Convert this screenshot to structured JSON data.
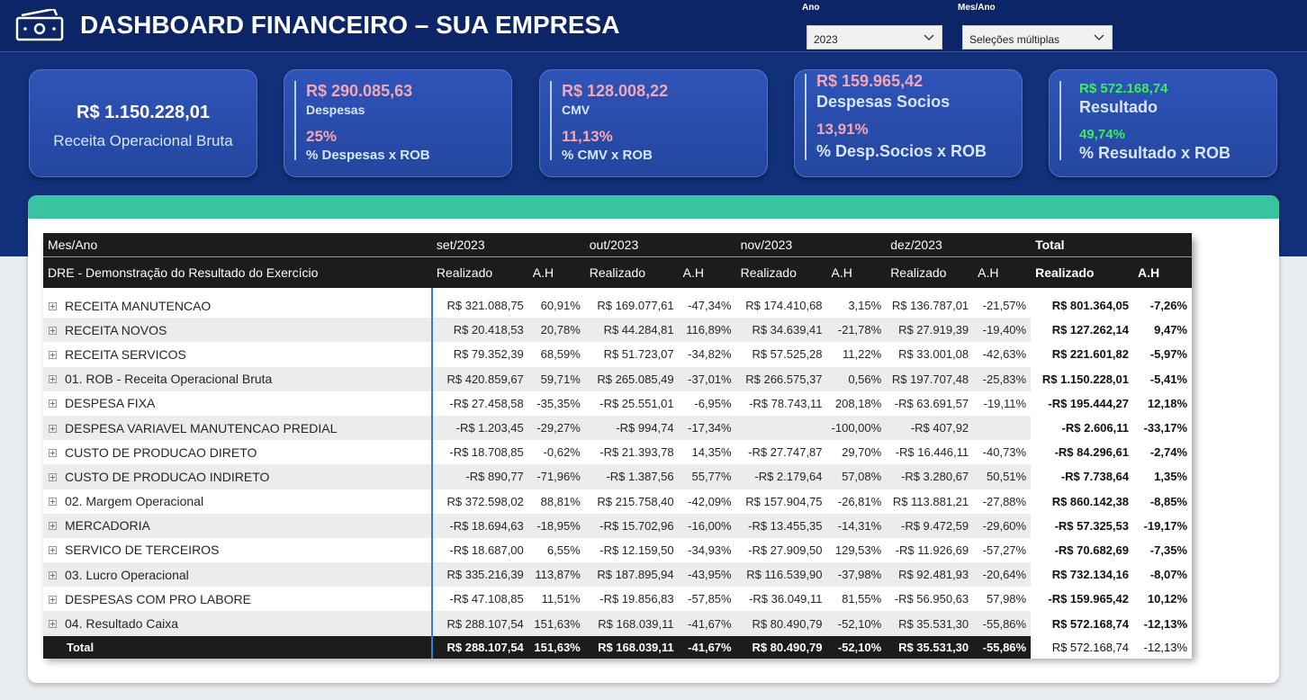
{
  "header": {
    "title": "DASHBOARD FINANCEIRO – SUA EMPRESA",
    "logo_icon": "money-bill-icon",
    "filters": [
      {
        "label": "Ano",
        "value": "2023"
      },
      {
        "label": "Mes/Ano",
        "value": "Seleções múltiplas"
      }
    ]
  },
  "cards": [
    {
      "value": "R$ 1.150.228,01",
      "label": "Receita Operacional Bruta"
    },
    {
      "value": "R$ 290.085,63",
      "label": "Despesas",
      "pct": "25%",
      "pct_label": "% Despesas x ROB"
    },
    {
      "value": "R$ 128.008,22",
      "label": "CMV",
      "pct": "11,13%",
      "pct_label": "% CMV x ROB"
    },
    {
      "value": "R$ 159.965,42",
      "label": "Despesas Socios",
      "pct": "13,91%",
      "pct_label": "% Desp.Socios x ROB"
    },
    {
      "value": "R$ 572.168,74",
      "label": "Resultado",
      "pct": "49,74%",
      "pct_label": "% Resultado x ROB"
    }
  ],
  "colors": {
    "pink": "#f4a6b6",
    "green": "#38ef5a",
    "teal": "#39c3a0",
    "navy": "#12307a"
  },
  "table": {
    "corner_top": "Mes/Ano",
    "corner_bottom": "DRE - Demonstração do Resultado do Exercício",
    "months": [
      "set/2023",
      "out/2023",
      "nov/2023",
      "dez/2023",
      "Total"
    ],
    "sub_realizado": "Realizado",
    "sub_ah": "A.H",
    "rows": [
      {
        "name": "RECEITA MANUTENCAO",
        "c": [
          "R$ 321.088,75",
          "60,91%",
          "R$ 169.077,61",
          "-47,34%",
          "R$ 174.410,68",
          "3,15%",
          "R$ 136.787,01",
          "-21,57%",
          "R$ 801.364,05",
          "-7,26%"
        ]
      },
      {
        "name": "RECEITA NOVOS",
        "c": [
          "R$ 20.418,53",
          "20,78%",
          "R$ 44.284,81",
          "116,89%",
          "R$ 34.639,41",
          "-21,78%",
          "R$ 27.919,39",
          "-19,40%",
          "R$ 127.262,14",
          "9,47%"
        ]
      },
      {
        "name": "RECEITA SERVICOS",
        "c": [
          "R$ 79.352,39",
          "68,59%",
          "R$ 51.723,07",
          "-34,82%",
          "R$ 57.525,28",
          "11,22%",
          "R$ 33.001,08",
          "-42,63%",
          "R$ 221.601,82",
          "-5,97%"
        ]
      },
      {
        "name": "01. ROB - Receita Operacional Bruta",
        "c": [
          "R$ 420.859,67",
          "59,71%",
          "R$ 265.085,49",
          "-37,01%",
          "R$ 266.575,37",
          "0,56%",
          "R$ 197.707,48",
          "-25,83%",
          "R$ 1.150.228,01",
          "-5,41%"
        ]
      },
      {
        "name": "DESPESA FIXA",
        "c": [
          "-R$ 27.458,58",
          "-35,35%",
          "-R$ 25.551,01",
          "-6,95%",
          "-R$ 78.743,11",
          "208,18%",
          "-R$ 63.691,57",
          "-19,11%",
          "-R$ 195.444,27",
          "12,18%"
        ]
      },
      {
        "name": "DESPESA VARIAVEL MANUTENCAO PREDIAL",
        "c": [
          "-R$ 1.203,45",
          "-29,27%",
          "-R$ 994,74",
          "-17,34%",
          "",
          "-100,00%",
          "-R$ 407,92",
          "",
          "-R$ 2.606,11",
          "-33,17%"
        ]
      },
      {
        "name": "CUSTO DE PRODUCAO DIRETO",
        "c": [
          "-R$ 18.708,85",
          "-0,62%",
          "-R$ 21.393,78",
          "14,35%",
          "-R$ 27.747,87",
          "29,70%",
          "-R$ 16.446,11",
          "-40,73%",
          "-R$ 84.296,61",
          "-2,74%"
        ]
      },
      {
        "name": "CUSTO DE PRODUCAO INDIRETO",
        "c": [
          "-R$ 890,77",
          "-71,96%",
          "-R$ 1.387,56",
          "55,77%",
          "-R$ 2.179,64",
          "57,08%",
          "-R$ 3.280,67",
          "50,51%",
          "-R$ 7.738,64",
          "1,35%"
        ]
      },
      {
        "name": "02. Margem Operacional",
        "c": [
          "R$ 372.598,02",
          "88,81%",
          "R$ 215.758,40",
          "-42,09%",
          "R$ 157.904,75",
          "-26,81%",
          "R$ 113.881,21",
          "-27,88%",
          "R$ 860.142,38",
          "-8,85%"
        ]
      },
      {
        "name": "MERCADORIA",
        "c": [
          "-R$ 18.694,63",
          "-18,95%",
          "-R$ 15.702,96",
          "-16,00%",
          "-R$ 13.455,35",
          "-14,31%",
          "-R$ 9.472,59",
          "-29,60%",
          "-R$ 57.325,53",
          "-19,17%"
        ]
      },
      {
        "name": "SERVICO DE TERCEIROS",
        "c": [
          "-R$ 18.687,00",
          "6,55%",
          "-R$ 12.159,50",
          "-34,93%",
          "-R$ 27.909,50",
          "129,53%",
          "-R$ 11.926,69",
          "-57,27%",
          "-R$ 70.682,69",
          "-7,35%"
        ]
      },
      {
        "name": "03. Lucro Operacional",
        "c": [
          "R$ 335.216,39",
          "113,87%",
          "R$ 187.895,94",
          "-43,95%",
          "R$ 116.539,90",
          "-37,98%",
          "R$ 92.481,93",
          "-20,64%",
          "R$ 732.134,16",
          "-8,07%"
        ]
      },
      {
        "name": "DESPESAS COM PRO LABORE",
        "c": [
          "-R$ 47.108,85",
          "11,51%",
          "-R$ 19.856,83",
          "-57,85%",
          "-R$ 36.049,11",
          "81,55%",
          "-R$ 56.950,63",
          "57,98%",
          "-R$ 159.965,42",
          "10,12%"
        ]
      },
      {
        "name": "04. Resultado Caixa",
        "c": [
          "R$ 288.107,54",
          "151,63%",
          "R$ 168.039,11",
          "-41,67%",
          "R$ 80.490,79",
          "-52,10%",
          "R$ 35.531,30",
          "-55,86%",
          "R$ 572.168,74",
          "-12,13%"
        ]
      }
    ],
    "total": {
      "name": "Total",
      "c": [
        "R$ 288.107,54",
        "151,63%",
        "R$ 168.039,11",
        "-41,67%",
        "R$ 80.490,79",
        "-52,10%",
        "R$ 35.531,30",
        "-55,86%",
        "R$ 572.168,74",
        "-12,13%"
      ]
    }
  }
}
